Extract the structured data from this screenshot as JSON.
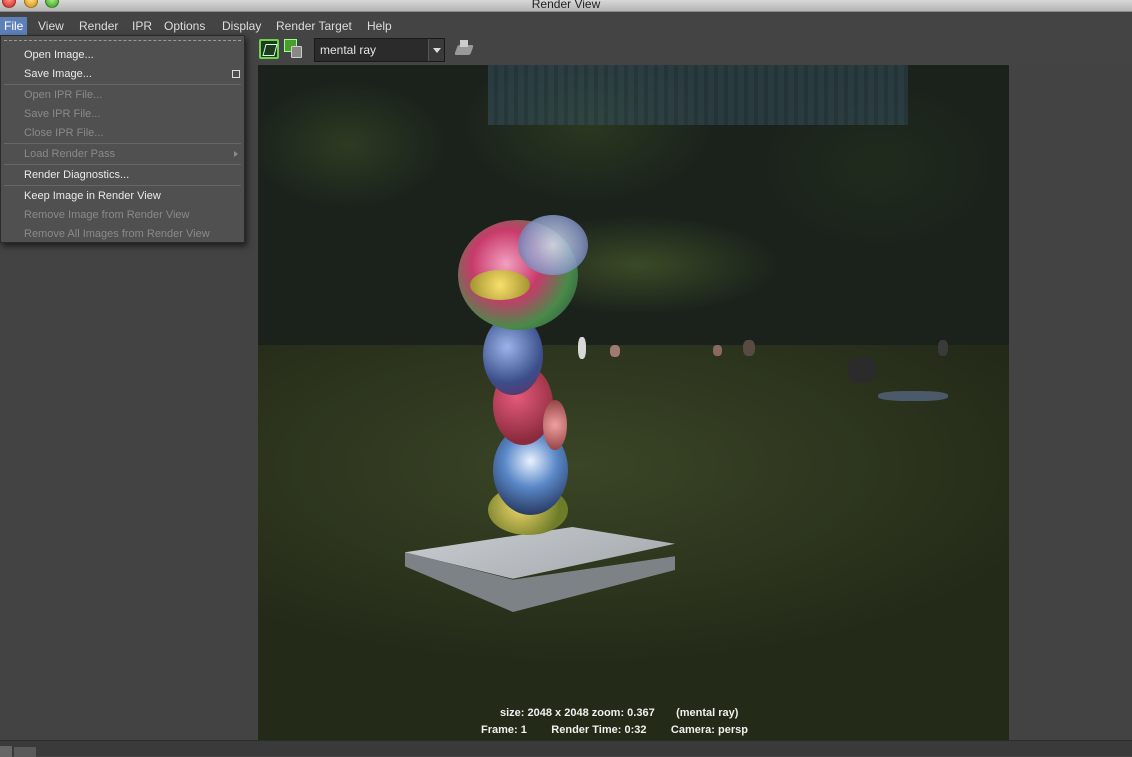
{
  "window": {
    "title": "Render View"
  },
  "menubar": {
    "items": [
      {
        "label": "File"
      },
      {
        "label": "View"
      },
      {
        "label": "Render"
      },
      {
        "label": "IPR"
      },
      {
        "label": "Options"
      },
      {
        "label": "Display"
      },
      {
        "label": "Render Target"
      },
      {
        "label": "Help"
      }
    ]
  },
  "toolbar": {
    "renderer": "mental ray"
  },
  "file_menu": {
    "items": [
      {
        "label": "Open Image...",
        "enabled": true
      },
      {
        "label": "Save Image...",
        "enabled": true
      },
      {
        "label": "Open IPR File...",
        "enabled": false
      },
      {
        "label": "Save IPR File...",
        "enabled": false
      },
      {
        "label": "Close IPR File...",
        "enabled": false
      },
      {
        "label": "Load Render Pass",
        "enabled": false
      },
      {
        "label": "Render Diagnostics...",
        "enabled": true
      },
      {
        "label": "Keep Image in Render View",
        "enabled": true
      },
      {
        "label": "Remove Image from Render View",
        "enabled": false
      },
      {
        "label": "Remove All Images from Render View",
        "enabled": false
      }
    ]
  },
  "render_info": {
    "line1": "size: 2048 x 2048 zoom: 0.367       (mental ray)",
    "line2": "Frame: 1        Render Time: 0:32        Camera: persp"
  },
  "colors": {
    "menu_highlight": "#5d80b7",
    "snapshot_icon": "#6ed24a"
  },
  "icons": [
    "close-icon",
    "minimize-icon",
    "maximize-icon",
    "snapshot-icon",
    "remove-image-icon",
    "dropdown-arrow-icon",
    "render-settings-icon"
  ]
}
